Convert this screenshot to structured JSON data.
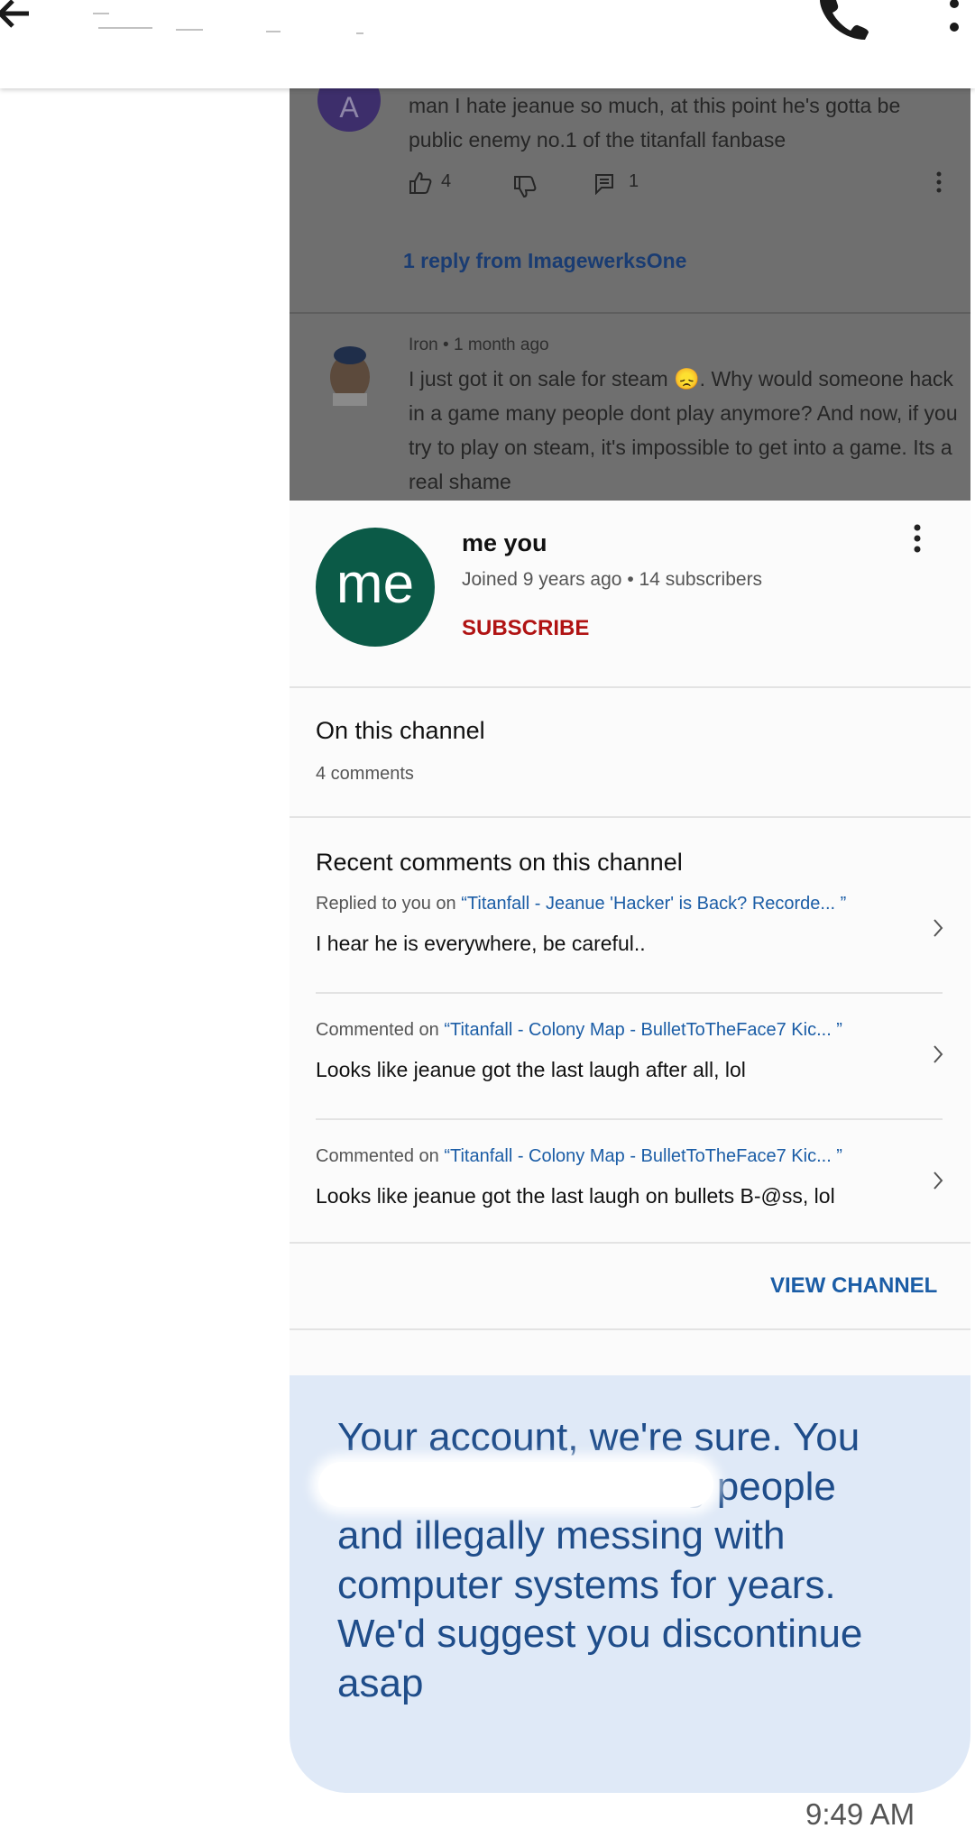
{
  "comments": {
    "first": {
      "avatar_letter": "A",
      "text": "man I hate jeanue so much, at this point he's gotta be public enemy no.1 of the titanfall fanbase",
      "likes": "4",
      "replies": "1",
      "reply_link": "1 reply from ImagewerksOne"
    },
    "second": {
      "author": "Iron",
      "age": "1 month ago",
      "text": "I just got it on sale for steam 😞. Why would someone hack in a game many people dont play anymore? And now, if you try to play on steam, it's impossible to get into a game. Its a real shame"
    }
  },
  "channel": {
    "avatar_text": "me",
    "name": "me you",
    "joined": "Joined 9 years ago",
    "subscribers": "14 subscribers",
    "subscribe_label": "SUBSCRIBE",
    "on_channel_title": "On this channel",
    "comment_count": "4 comments",
    "recent_title": "Recent comments on this channel",
    "recent": [
      {
        "prefix": "Replied to you on",
        "video": "Titanfall - Jeanue 'Hacker' is Back? Recorde...",
        "text": "I hear he is everywhere, be careful.."
      },
      {
        "prefix": "Commented on",
        "video": "Titanfall - Colony Map - BulletToTheFace7 Kic...",
        "text": "Looks like jeanue got the last laugh after all, lol"
      },
      {
        "prefix": "Commented on",
        "video": "Titanfall - Colony Map - BulletToTheFace7 Kic...",
        "text": "Looks like jeanue got the last laugh on bullets B-@ss, lol"
      }
    ],
    "view_channel_label": "VIEW CHANNEL"
  },
  "message": {
    "text": "Your account, we're sure. You have been harassing people and illegally messing with computer systems for years. We'd suggest you discontinue asap",
    "time": "9:49 AM"
  },
  "colors": {
    "bubble_bg": "#dfe9f7",
    "bubble_text": "#1f4d8a",
    "subscribe": "#b01313",
    "link": "#1b5da6",
    "channel_avatar": "#0b5a47"
  }
}
